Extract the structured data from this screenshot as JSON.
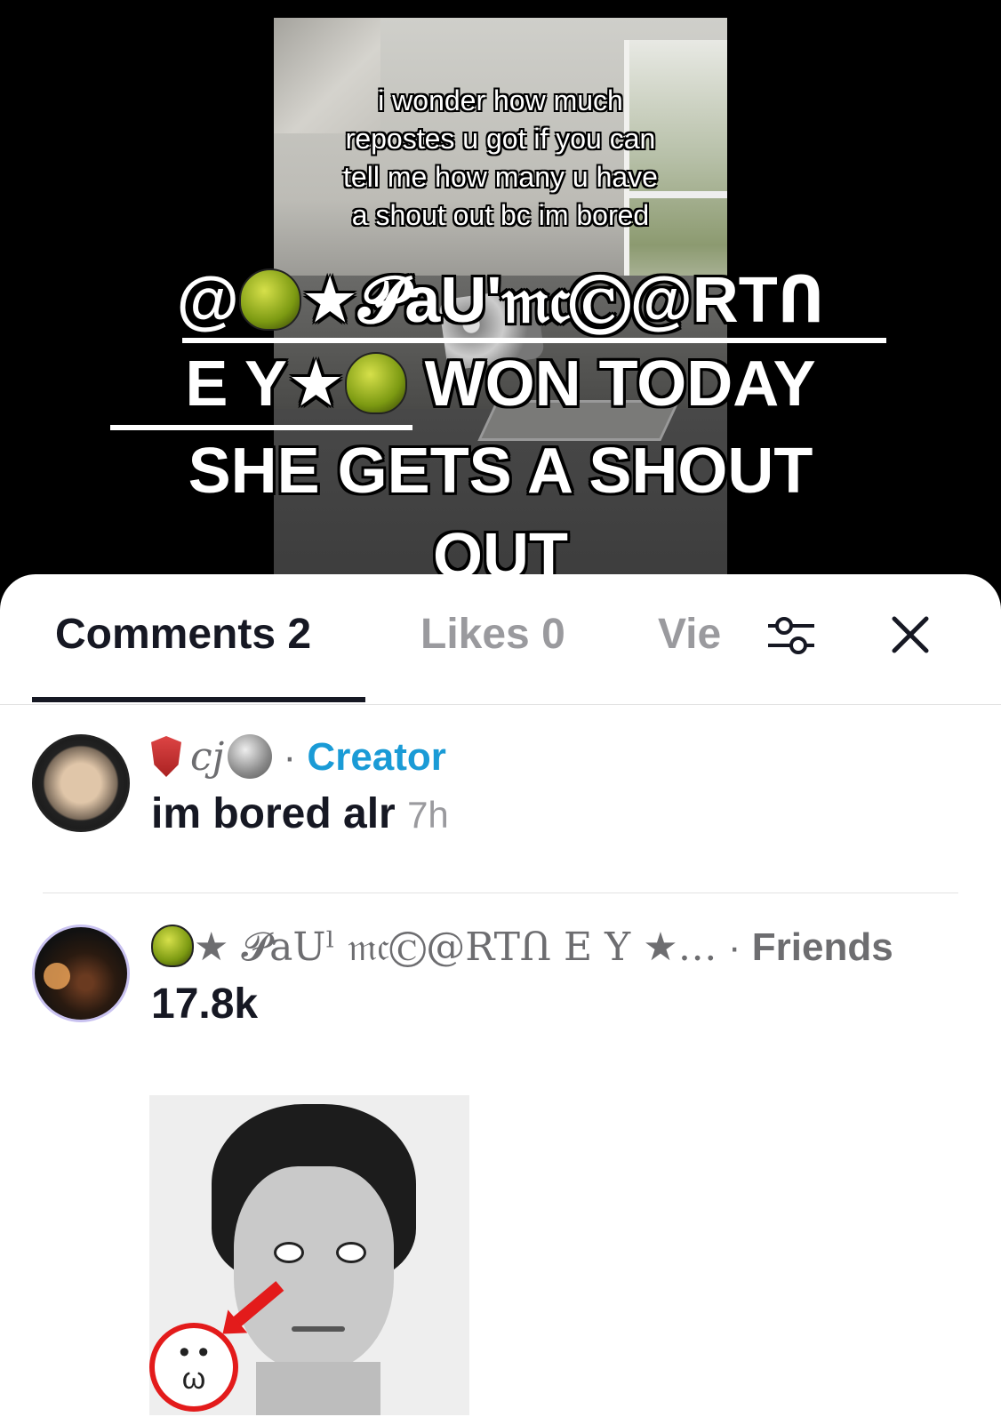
{
  "video": {
    "caption_small_lines": [
      "i wonder how much",
      "repostes u got if you can",
      "tell me how many u have",
      "a shout out bc im bored"
    ],
    "caption_big": {
      "line1_name": "★𝓟aU'𝔪𝔠Ⓒ@RTՈ",
      "line2_name": "E Y★",
      "line2_rest": " WON TODAY",
      "line3": "SHE GETS A SHOUT",
      "line4": "OUT"
    },
    "mention_symbol": "@"
  },
  "sheet": {
    "tabs": [
      {
        "label": "Comments 2",
        "active": true
      },
      {
        "label": "Likes 0",
        "active": false
      },
      {
        "label": "Vie",
        "active": false
      }
    ],
    "icons": {
      "filter": "filter-icon",
      "close": "close-icon"
    }
  },
  "comments": [
    {
      "username": "cj",
      "separator": "·",
      "role": "Creator",
      "text": "im bored alr",
      "time": "7h",
      "icons": [
        "shield-icon",
        "coin-icon"
      ]
    },
    {
      "username": "★ 𝓟aUˡ 𝔪𝔠Ⓒ@RTՈ E Y ★…",
      "separator": "·",
      "role": "Friends",
      "text": "17.8k",
      "icons": [
        "beetle-icon"
      ],
      "sticker_text": "• •\nω"
    }
  ],
  "colors": {
    "creator": "#1a9bd6",
    "text": "#161823",
    "muted": "#9a9a9e",
    "annotation_red": "#e31b1b"
  }
}
